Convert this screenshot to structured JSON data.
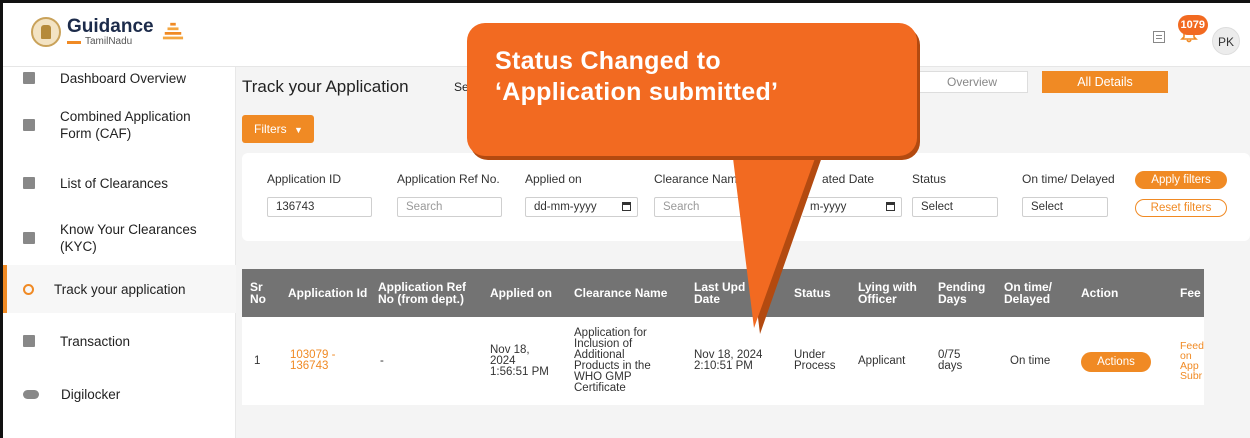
{
  "header": {
    "logo_title": "Guidance",
    "logo_sub": "TamilNadu",
    "notification_count": "1079",
    "avatar_initials": "PK"
  },
  "sidebar": {
    "items": [
      {
        "label": "Dashboard Overview",
        "icon": "dashboard-icon"
      },
      {
        "label": "Combined Application Form (CAF)",
        "icon": "document-icon"
      },
      {
        "label": "List of Clearances",
        "icon": "list-icon"
      },
      {
        "label": "Know Your Clearances (KYC)",
        "icon": "book-icon"
      },
      {
        "label": "Track your application",
        "icon": "location-pin-icon",
        "active": true
      },
      {
        "label": "Transaction",
        "icon": "transaction-icon"
      },
      {
        "label": "Digilocker",
        "icon": "cloud-icon"
      }
    ]
  },
  "main": {
    "title": "Track your Application",
    "title_suffix": "Se",
    "tabs": {
      "overview": "Overview",
      "all_details": "All Details"
    },
    "filters_label": "Filters"
  },
  "filters": {
    "application_id": {
      "label": "Application ID",
      "value": "136743"
    },
    "application_ref": {
      "label": "Application Ref No.",
      "placeholder": "Search"
    },
    "applied_on": {
      "label": "Applied on",
      "placeholder": "dd-mm-yyyy"
    },
    "clearance_name": {
      "label": "Clearance Nam",
      "placeholder": "Search"
    },
    "updated_date": {
      "label": "ated Date",
      "placeholder": "m-yyyy"
    },
    "status": {
      "label": "Status",
      "placeholder": "Select"
    },
    "on_time": {
      "label": "On time/ Delayed",
      "placeholder": "Select"
    },
    "apply_label": "Apply filters",
    "reset_label": "Reset filters"
  },
  "table": {
    "headers": {
      "sr": "Sr No",
      "app_id": "Application Id",
      "app_ref": "Application Ref No (from dept.)",
      "applied_on": "Applied on",
      "clearance": "Clearance Name",
      "last_update": "Last Upd Date",
      "status": "Status",
      "lying": "Lying with Officer",
      "pending": "Pending Days",
      "ontime": "On time/ Delayed",
      "action": "Action",
      "feedback": "Fee"
    },
    "row": {
      "sr": "1",
      "app_id": "103079 - 136743",
      "app_ref": "-",
      "applied_on": "Nov 18, 2024 1:56:51 PM",
      "clearance": "Application for Inclusion of Additional Products in the WHO GMP Certificate",
      "last_update": "Nov 18, 2024 2:10:51 PM",
      "status": "Under Process",
      "lying": "Applicant",
      "pending": "0/75 days",
      "ontime": "On time",
      "action_label": "Actions",
      "feedback": "Feed on App Subr"
    }
  },
  "callout": {
    "line1": "Status Changed to",
    "line2": "‘Application submitted’"
  },
  "colors": {
    "accent": "#f08a24",
    "callout": "#f26a21",
    "table_header": "#737373"
  }
}
